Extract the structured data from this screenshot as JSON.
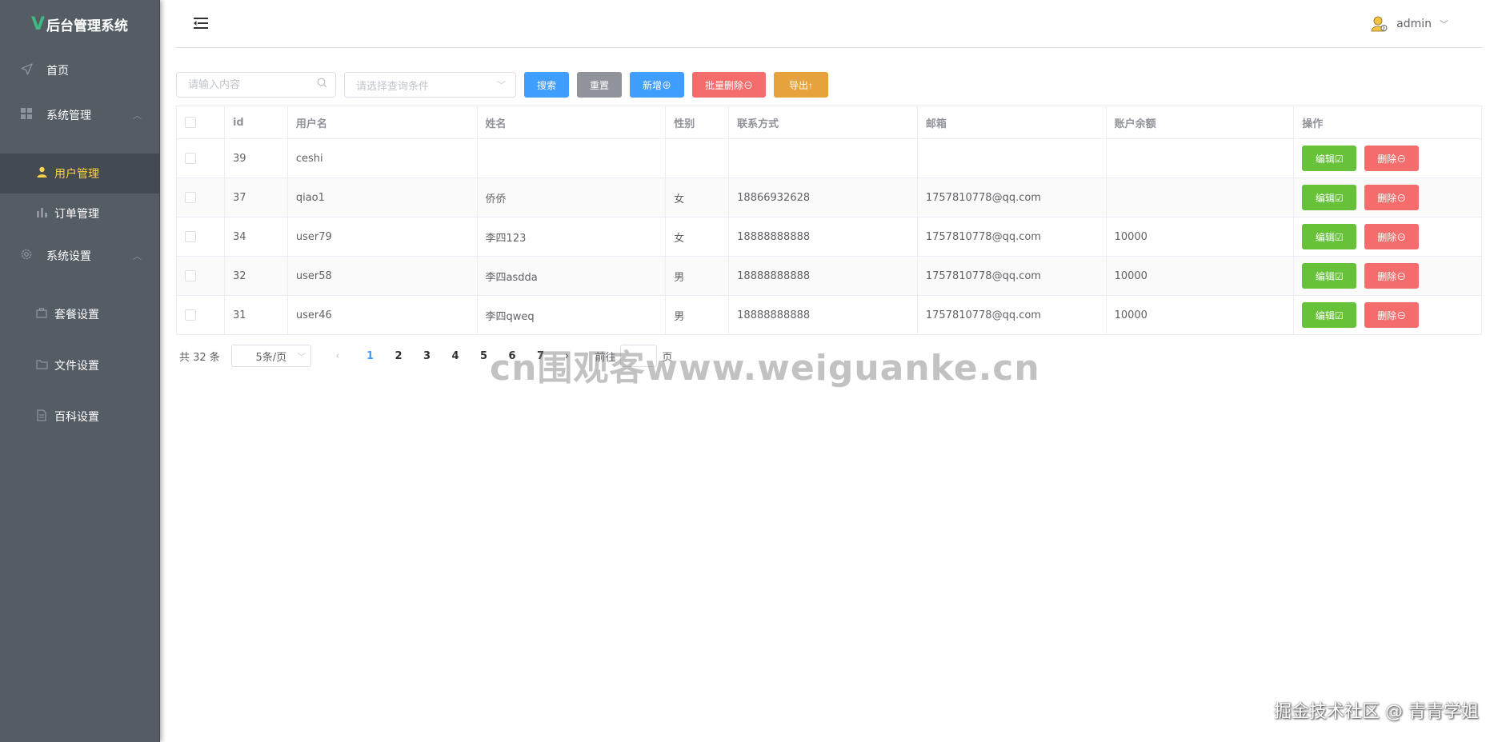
{
  "app": {
    "logo_mark": "V",
    "title": "后台管理系统"
  },
  "sidebar": {
    "home": "首页",
    "system_manage": "系统管理",
    "user_manage": "用户管理",
    "order_manage": "订单管理",
    "system_settings": "系统设置",
    "package_settings": "套餐设置",
    "file_settings": "文件设置",
    "wiki_settings": "百科设置"
  },
  "header": {
    "username": "admin"
  },
  "toolbar": {
    "search_placeholder": "请输入内容",
    "select_placeholder": "请选择查询条件",
    "search_label": "搜索",
    "reset_label": "重置",
    "add_label": "新增⊕",
    "batch_delete_label": "批量删除⊖",
    "export_label": "导出↑"
  },
  "table": {
    "headers": {
      "id": "id",
      "username": "用户名",
      "name": "姓名",
      "gender": "性别",
      "phone": "联系方式",
      "email": "邮箱",
      "balance": "账户余额",
      "actions": "操作"
    },
    "edit_label": "编辑☑",
    "delete_label": "删除⊖",
    "rows": [
      {
        "id": "39",
        "username": "ceshi",
        "name": "",
        "gender": "",
        "phone": "",
        "email": "",
        "balance": ""
      },
      {
        "id": "37",
        "username": "qiao1",
        "name": "侨侨",
        "gender": "女",
        "phone": "18866932628",
        "email": "1757810778@qq.com",
        "balance": ""
      },
      {
        "id": "34",
        "username": "user79",
        "name": "李四123",
        "gender": "女",
        "phone": "18888888888",
        "email": "1757810778@qq.com",
        "balance": "10000"
      },
      {
        "id": "32",
        "username": "user58",
        "name": "李四asdda",
        "gender": "男",
        "phone": "18888888888",
        "email": "1757810778@qq.com",
        "balance": "10000"
      },
      {
        "id": "31",
        "username": "user46",
        "name": "李四qweq",
        "gender": "男",
        "phone": "18888888888",
        "email": "1757810778@qq.com",
        "balance": "10000"
      }
    ]
  },
  "pagination": {
    "total": "共 32 条",
    "page_size": "5条/页",
    "pages": [
      "1",
      "2",
      "3",
      "4",
      "5",
      "6",
      "7"
    ],
    "current": "1",
    "goto_prefix": "前往",
    "goto_suffix": "页"
  },
  "watermarks": {
    "center": "cn围观客www.weiguanke.cn",
    "corner": "掘金技术社区 @ 青青学姐"
  },
  "colors": {
    "sidebar_bg": "#545c64",
    "active_text": "#ffd04b",
    "primary": "#409eff",
    "success": "#67c23a",
    "danger": "#f56c6c",
    "warning": "#e6a23c",
    "info": "#909399"
  }
}
